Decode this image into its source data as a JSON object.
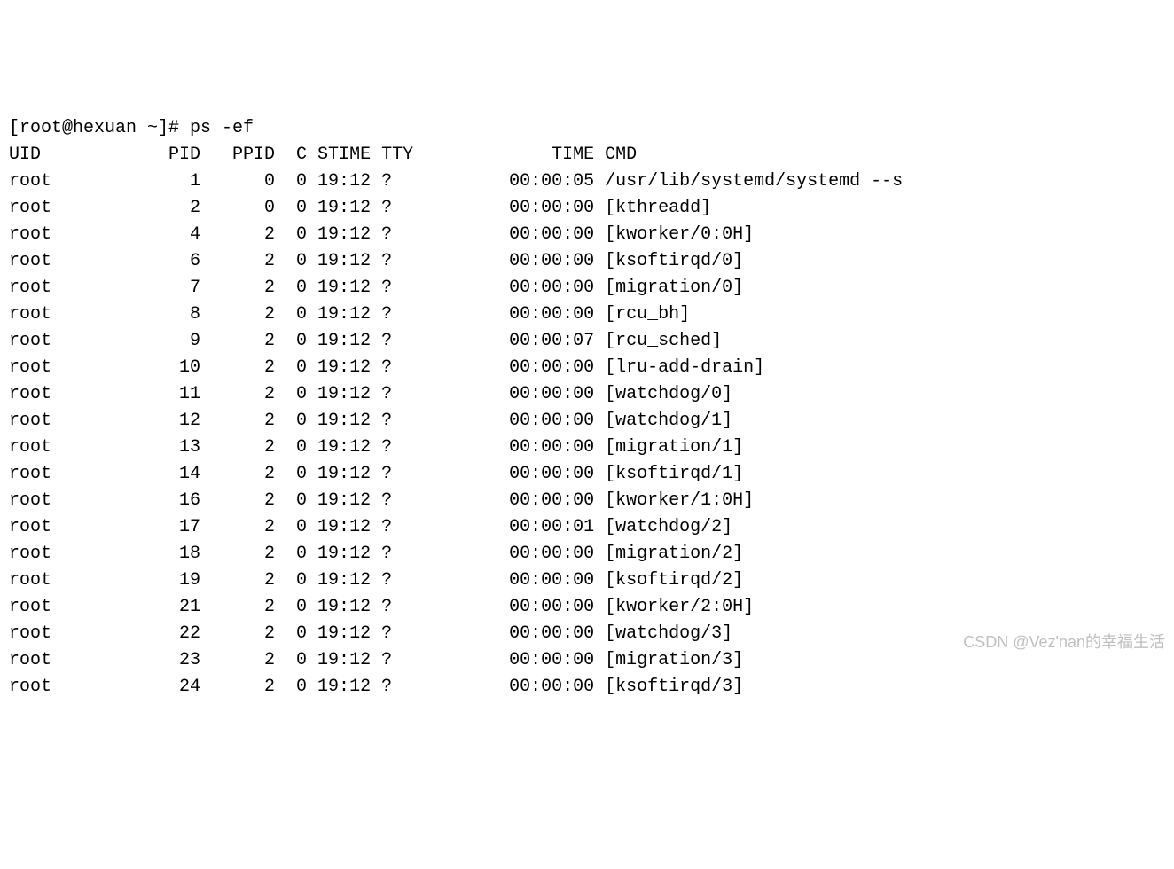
{
  "prompt": "[root@hexuan ~]# ps -ef",
  "header": {
    "uid": "UID",
    "pid": "PID",
    "ppid": "PPID",
    "c": "C",
    "stime": "STIME",
    "tty": "TTY",
    "time": "TIME",
    "cmd": "CMD"
  },
  "rows": [
    {
      "uid": "root",
      "pid": "1",
      "ppid": "0",
      "c": "0",
      "stime": "19:12",
      "tty": "?",
      "time": "00:00:05",
      "cmd": "/usr/lib/systemd/systemd --s"
    },
    {
      "uid": "root",
      "pid": "2",
      "ppid": "0",
      "c": "0",
      "stime": "19:12",
      "tty": "?",
      "time": "00:00:00",
      "cmd": "[kthreadd]"
    },
    {
      "uid": "root",
      "pid": "4",
      "ppid": "2",
      "c": "0",
      "stime": "19:12",
      "tty": "?",
      "time": "00:00:00",
      "cmd": "[kworker/0:0H]"
    },
    {
      "uid": "root",
      "pid": "6",
      "ppid": "2",
      "c": "0",
      "stime": "19:12",
      "tty": "?",
      "time": "00:00:00",
      "cmd": "[ksoftirqd/0]"
    },
    {
      "uid": "root",
      "pid": "7",
      "ppid": "2",
      "c": "0",
      "stime": "19:12",
      "tty": "?",
      "time": "00:00:00",
      "cmd": "[migration/0]"
    },
    {
      "uid": "root",
      "pid": "8",
      "ppid": "2",
      "c": "0",
      "stime": "19:12",
      "tty": "?",
      "time": "00:00:00",
      "cmd": "[rcu_bh]"
    },
    {
      "uid": "root",
      "pid": "9",
      "ppid": "2",
      "c": "0",
      "stime": "19:12",
      "tty": "?",
      "time": "00:00:07",
      "cmd": "[rcu_sched]"
    },
    {
      "uid": "root",
      "pid": "10",
      "ppid": "2",
      "c": "0",
      "stime": "19:12",
      "tty": "?",
      "time": "00:00:00",
      "cmd": "[lru-add-drain]"
    },
    {
      "uid": "root",
      "pid": "11",
      "ppid": "2",
      "c": "0",
      "stime": "19:12",
      "tty": "?",
      "time": "00:00:00",
      "cmd": "[watchdog/0]"
    },
    {
      "uid": "root",
      "pid": "12",
      "ppid": "2",
      "c": "0",
      "stime": "19:12",
      "tty": "?",
      "time": "00:00:00",
      "cmd": "[watchdog/1]"
    },
    {
      "uid": "root",
      "pid": "13",
      "ppid": "2",
      "c": "0",
      "stime": "19:12",
      "tty": "?",
      "time": "00:00:00",
      "cmd": "[migration/1]"
    },
    {
      "uid": "root",
      "pid": "14",
      "ppid": "2",
      "c": "0",
      "stime": "19:12",
      "tty": "?",
      "time": "00:00:00",
      "cmd": "[ksoftirqd/1]"
    },
    {
      "uid": "root",
      "pid": "16",
      "ppid": "2",
      "c": "0",
      "stime": "19:12",
      "tty": "?",
      "time": "00:00:00",
      "cmd": "[kworker/1:0H]"
    },
    {
      "uid": "root",
      "pid": "17",
      "ppid": "2",
      "c": "0",
      "stime": "19:12",
      "tty": "?",
      "time": "00:00:01",
      "cmd": "[watchdog/2]"
    },
    {
      "uid": "root",
      "pid": "18",
      "ppid": "2",
      "c": "0",
      "stime": "19:12",
      "tty": "?",
      "time": "00:00:00",
      "cmd": "[migration/2]"
    },
    {
      "uid": "root",
      "pid": "19",
      "ppid": "2",
      "c": "0",
      "stime": "19:12",
      "tty": "?",
      "time": "00:00:00",
      "cmd": "[ksoftirqd/2]"
    },
    {
      "uid": "root",
      "pid": "21",
      "ppid": "2",
      "c": "0",
      "stime": "19:12",
      "tty": "?",
      "time": "00:00:00",
      "cmd": "[kworker/2:0H]"
    },
    {
      "uid": "root",
      "pid": "22",
      "ppid": "2",
      "c": "0",
      "stime": "19:12",
      "tty": "?",
      "time": "00:00:00",
      "cmd": "[watchdog/3]"
    },
    {
      "uid": "root",
      "pid": "23",
      "ppid": "2",
      "c": "0",
      "stime": "19:12",
      "tty": "?",
      "time": "00:00:00",
      "cmd": "[migration/3]"
    },
    {
      "uid": "root",
      "pid": "24",
      "ppid": "2",
      "c": "0",
      "stime": "19:12",
      "tty": "?",
      "time": "00:00:00",
      "cmd": "[ksoftirqd/3]"
    }
  ],
  "watermark": "CSDN @Vez'nan的幸福生活"
}
